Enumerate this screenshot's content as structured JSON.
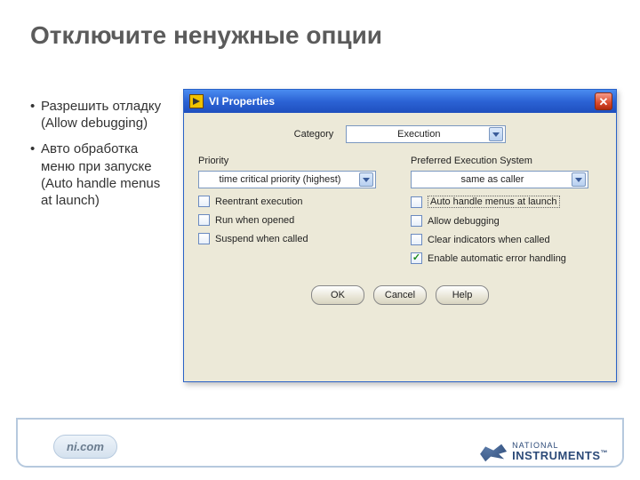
{
  "slide": {
    "title": "Отключите ненужные опции",
    "bullets": [
      "Разрешить отладку (Allow debugging)",
      "Авто обработка меню при запуске (Auto handle menus at launch)"
    ],
    "pill": "ni.com",
    "logo_top": "NATIONAL",
    "logo_bottom": "INSTRUMENTS",
    "logo_tm": "™"
  },
  "window": {
    "title": "VI Properties",
    "category_label": "Category",
    "category_value": "Execution",
    "left": {
      "priority_label": "Priority",
      "priority_value": "time critical priority (highest)",
      "checks": [
        {
          "label": "Reentrant execution",
          "checked": false
        },
        {
          "label": "Run when opened",
          "checked": false
        },
        {
          "label": "Suspend when called",
          "checked": false
        }
      ]
    },
    "right": {
      "exec_label": "Preferred Execution System",
      "exec_value": "same as caller",
      "checks": [
        {
          "label": "Auto handle menus at launch",
          "checked": false,
          "highlight": true
        },
        {
          "label": "Allow debugging",
          "checked": false
        },
        {
          "label": "Clear indicators when called",
          "checked": false
        },
        {
          "label": "Enable automatic error handling",
          "checked": true
        }
      ]
    },
    "buttons": {
      "ok": "OK",
      "cancel": "Cancel",
      "help": "Help"
    }
  }
}
